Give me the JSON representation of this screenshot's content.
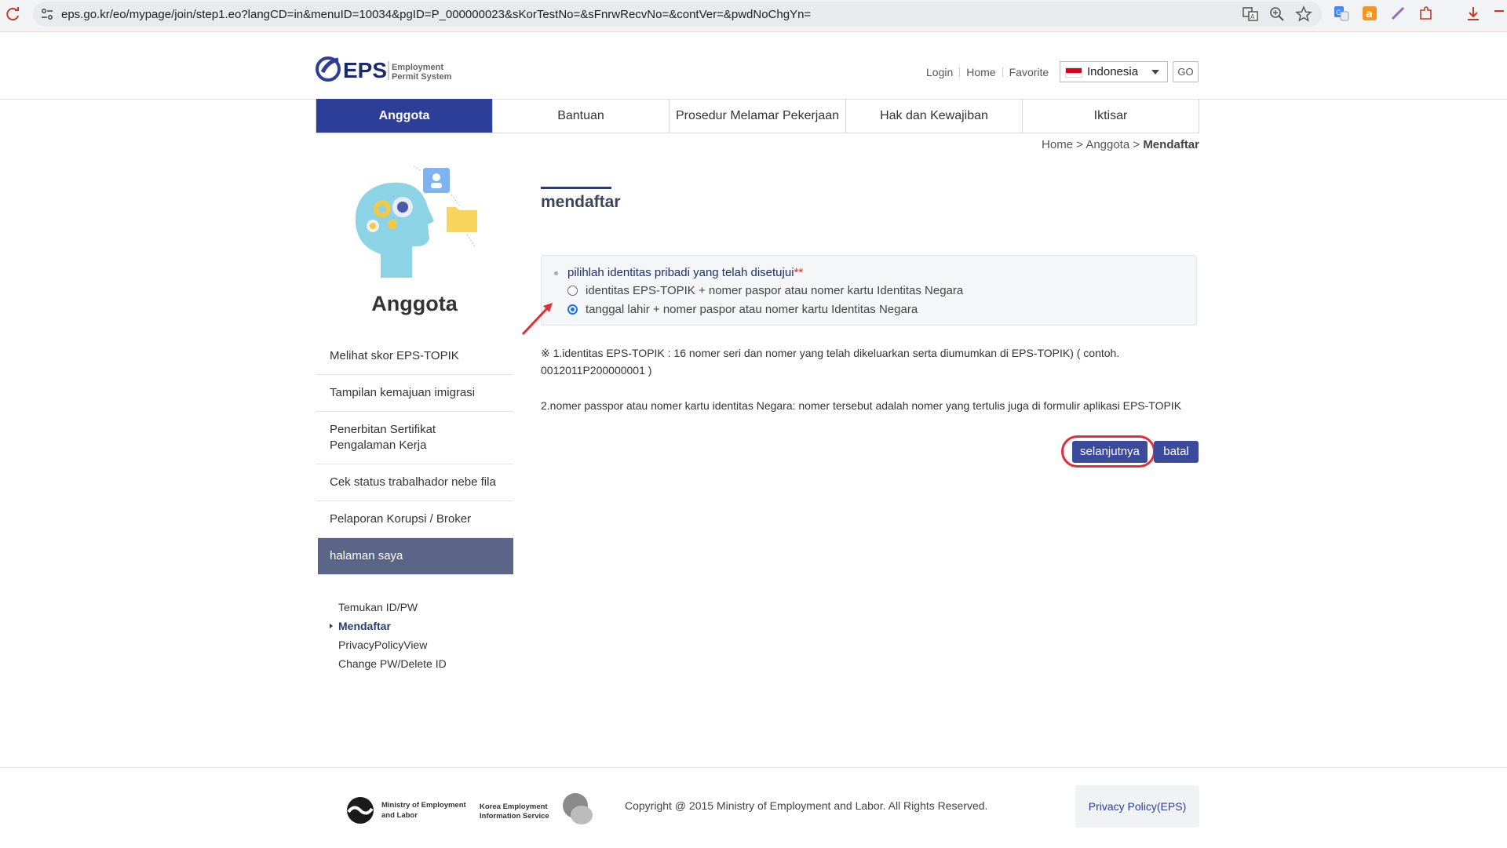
{
  "browser": {
    "url": "eps.go.kr/eo/mypage/join/step1.eo?langCD=in&menuID=10034&pgID=P_000000023&sKorTestNo=&sFnrwRecvNo=&contVer=&pwdNoChgYn="
  },
  "header": {
    "util_links": [
      "Login",
      "Home",
      "Favorite"
    ],
    "language": "Indonesia",
    "go_label": "GO"
  },
  "nav": {
    "items": [
      "Anggota",
      "Bantuan",
      "Prosedur Melamar Pekerjaan",
      "Hak dan Kewajiban",
      "Iktisar"
    ],
    "active_index": 0
  },
  "breadcrumb": {
    "home": "Home",
    "sep1": ">",
    "section": "Anggota",
    "sep2": ">",
    "current": "Mendaftar"
  },
  "sidebar": {
    "title": "Anggota",
    "items": [
      "Melihat skor EPS-TOPIK",
      "Tampilan kemajuan imigrasi",
      "Penerbitan Sertifikat Pengalaman Kerja",
      "Cek status trabalhador nebe fila",
      "Pelaporan Korupsi / Broker",
      "halaman saya"
    ],
    "sub_items": [
      "Temukan ID/PW",
      "Mendaftar",
      "PrivacyPolicyView",
      "Change PW/Delete ID"
    ]
  },
  "content": {
    "title": "mendaftar",
    "question": "pilihlah identitas pribadi yang telah disetujui",
    "question_marker": "**",
    "options": [
      {
        "label": "identitas EPS-TOPIK + nomer paspor atau nomer kartu Identitas Negara",
        "checked": false
      },
      {
        "label": "tanggal lahir + nomer paspor atau nomer kartu Identitas Negara",
        "checked": true
      }
    ],
    "note1": "※ 1.identitas EPS-TOPIK : 16 nomer seri dan nomer yang telah dikeluarkan serta diumumkan di EPS-TOPIK) ( contoh. 0012011P200000001 )",
    "note2": "2.nomer passpor atau nomer kartu identitas Negara: nomer tersebut adalah nomer yang tertulis juga di formulir aplikasi EPS-TOPIK",
    "next_label": "selanjutnya",
    "cancel_label": "batal"
  },
  "footer": {
    "ministry_logo_text": "Ministry of Employment and Labor",
    "keis_logo_text": "Korea Employment Information Service",
    "copyright": "Copyright @ 2015 Ministry of Employment and Labor. All Rights Reserved.",
    "privacy_label": "Privacy Policy(EPS)"
  },
  "colors": {
    "nav_active": "#2c3e97",
    "button": "#3b4a9a",
    "sidebar_active": "#5b6587",
    "annotation_red": "#e02e3a"
  }
}
